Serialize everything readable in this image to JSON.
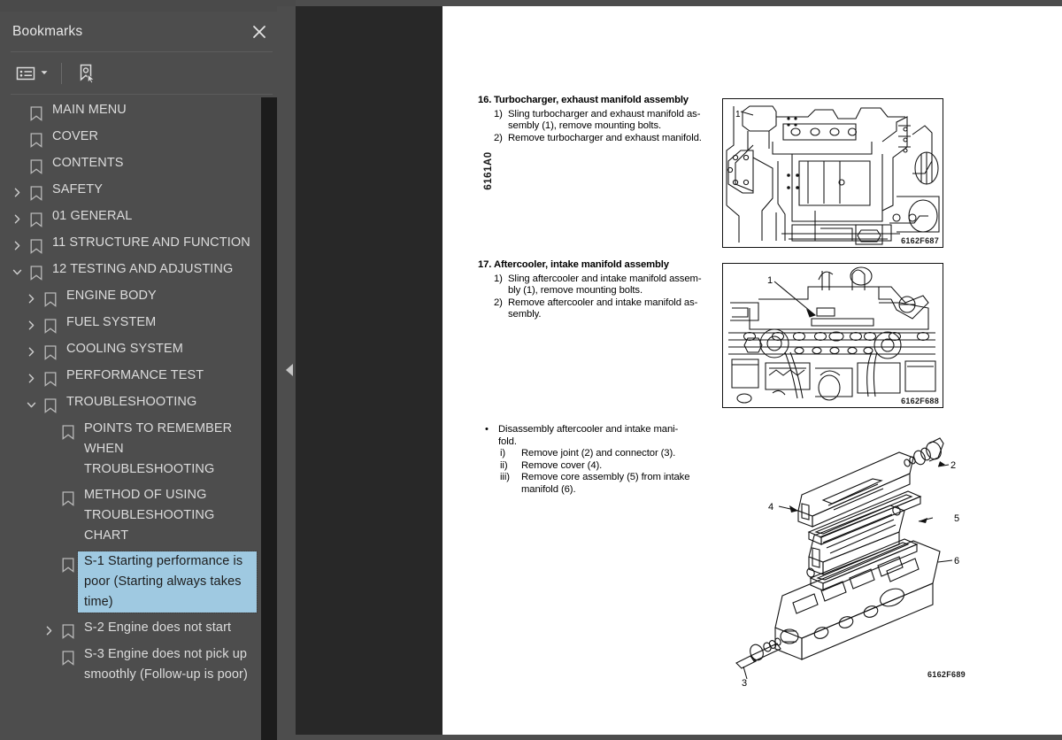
{
  "panel": {
    "title": "Bookmarks",
    "close_label": "×",
    "toolbar": {
      "options_icon": "list-options-icon",
      "dropdown_icon": "chevron-down-icon",
      "new_bookmark_icon": "bookmark-pointer-icon"
    },
    "tree": [
      {
        "label": "MAIN MENU",
        "level": 0,
        "chevron": "none",
        "selected": false
      },
      {
        "label": "COVER",
        "level": 0,
        "chevron": "none",
        "selected": false
      },
      {
        "label": "CONTENTS",
        "level": 0,
        "chevron": "none",
        "selected": false
      },
      {
        "label": "SAFETY",
        "level": 0,
        "chevron": "collapsed",
        "selected": false
      },
      {
        "label": "01 GENERAL",
        "level": 0,
        "chevron": "collapsed",
        "selected": false
      },
      {
        "label": "11 STRUCTURE AND FUNCTION",
        "level": 0,
        "chevron": "collapsed",
        "selected": false
      },
      {
        "label": "12 TESTING AND ADJUSTING",
        "level": 0,
        "chevron": "expanded",
        "selected": false
      },
      {
        "label": "ENGINE BODY",
        "level": 1,
        "chevron": "collapsed",
        "selected": false
      },
      {
        "label": "FUEL SYSTEM",
        "level": 1,
        "chevron": "collapsed",
        "selected": false
      },
      {
        "label": "COOLING SYSTEM",
        "level": 1,
        "chevron": "collapsed",
        "selected": false
      },
      {
        "label": "PERFORMANCE TEST",
        "level": 1,
        "chevron": "collapsed",
        "selected": false
      },
      {
        "label": "TROUBLESHOOTING",
        "level": 1,
        "chevron": "expanded",
        "selected": false
      },
      {
        "label": "POINTS TO REMEMBER WHEN TROUBLESHOOTING",
        "level": 2,
        "chevron": "none",
        "selected": false
      },
      {
        "label": "METHOD OF USING TROUBLESHOOTING CHART",
        "level": 2,
        "chevron": "none",
        "selected": false
      },
      {
        "label": "S-1 Starting performance is poor (Starting always takes time)",
        "level": 2,
        "chevron": "none",
        "selected": true
      },
      {
        "label": "S-2 Engine does not start",
        "level": 2,
        "chevron": "collapsed",
        "selected": false
      },
      {
        "label": "S-3 Engine does not pick up smoothly (Follow-up is poor)",
        "level": 2,
        "chevron": "none",
        "selected": false
      }
    ],
    "scrollbar": {
      "name": "bookmarks-scrollbar"
    },
    "collapse_handle_icon": "collapse-left-icon"
  },
  "document": {
    "side_code": "6161A0",
    "sections": [
      {
        "number": "16.",
        "heading": "Turbocharger, exhaust manifold assembly",
        "items": [
          {
            "marker": "1)",
            "lines": [
              "Sling  turbocharger  and  exhaust  manifold  as-",
              "sembly (1), remove mounting bolts."
            ]
          },
          {
            "marker": "2)",
            "lines": [
              "Remove turbocharger and exhaust manifold."
            ]
          }
        ]
      },
      {
        "number": "17.",
        "heading": "Aftercooler, intake manifold assembly",
        "items": [
          {
            "marker": "1)",
            "lines": [
              "Sling  aftercooler  and  intake  manifold  assem-",
              "bly (1), remove mounting bolts."
            ]
          },
          {
            "marker": "2)",
            "lines": [
              "Remove  aftercooler  and  intake  manifold  as-",
              "sembly."
            ]
          }
        ]
      }
    ],
    "bullet_block": {
      "bullet": "•",
      "lines": [
        "Disassembly  aftercooler  and  intake  mani-",
        "fold."
      ],
      "sub_items": [
        {
          "marker": "i)",
          "lines": [
            "Remove joint (2) and connector (3)."
          ]
        },
        {
          "marker": "ii)",
          "lines": [
            "Remove cover (4)."
          ]
        },
        {
          "marker": "iii)",
          "lines": [
            "Remove core assembly (5) from intake",
            "manifold (6)."
          ]
        }
      ]
    },
    "figures": [
      {
        "code": "6162F687",
        "callouts": [
          "1"
        ],
        "alt": "engine-turbocharger-exhaust-manifold-drawing"
      },
      {
        "code": "6162F688",
        "callouts": [
          "1"
        ],
        "alt": "aftercooler-intake-manifold-drawing"
      },
      {
        "code": "6162F689",
        "callouts": [
          "2",
          "3",
          "4",
          "5",
          "6"
        ],
        "alt": "aftercooler-exploded-view-drawing"
      }
    ]
  },
  "colors": {
    "panel_bg": "#4d4d4d",
    "viewer_bg": "#282828",
    "page_bg": "#ffffff",
    "selection": "#9fc9e1",
    "text": "#dcdcdc",
    "scrollbar_thumb": "#a8a8a8"
  }
}
